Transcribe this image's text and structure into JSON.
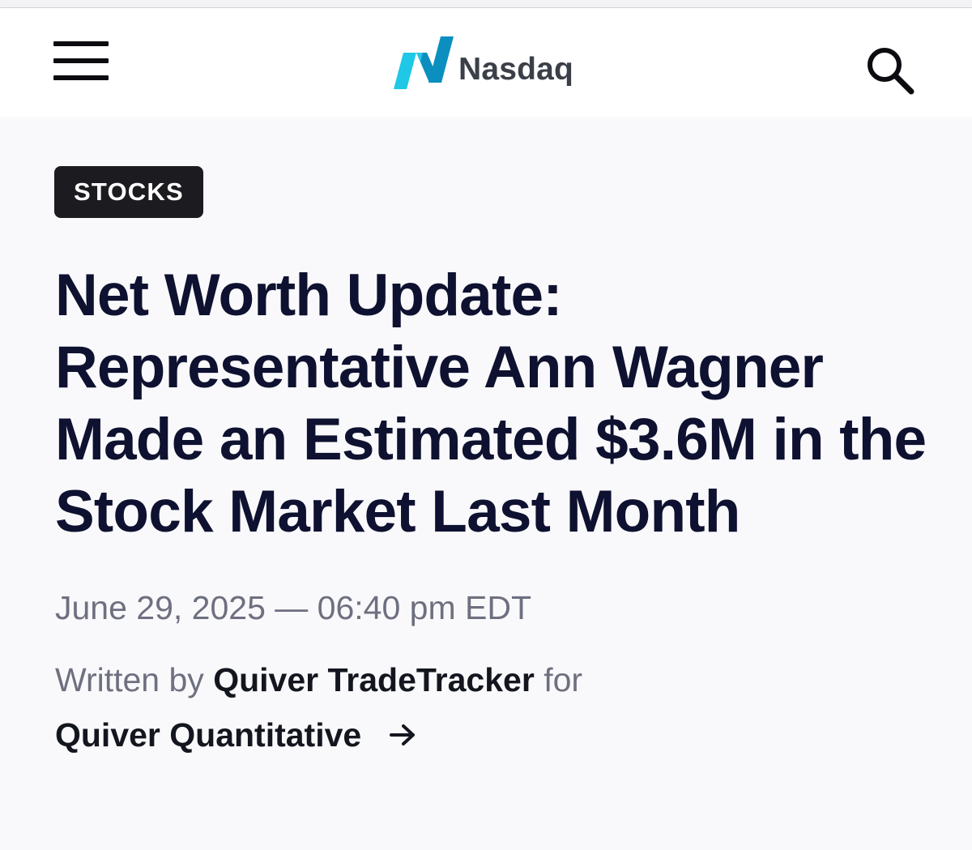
{
  "header": {
    "brand_name": "Nasdaq",
    "menu_icon": "hamburger-menu-icon",
    "search_icon": "magnifier-search-icon",
    "brand_colors": {
      "logo_dark": "#0996c7",
      "logo_light": "#1ec8e6",
      "text": "#3b3f48"
    }
  },
  "article": {
    "category": "STOCKS",
    "headline": "Net Worth Update: Representative Ann Wagner Made an Estimated $3.6M in the Stock Market Last Month",
    "dateline": "June 29, 2025 — 06:40 pm EDT",
    "byline": {
      "prefix": "Written by",
      "author": "Quiver TradeTracker",
      "connector": "for",
      "source": "Quiver Quantitative",
      "source_icon": "arrow-right-icon"
    }
  },
  "colors": {
    "headline": "#0e1130",
    "muted_text": "#6e7080",
    "badge_bg": "#1c1c20"
  }
}
